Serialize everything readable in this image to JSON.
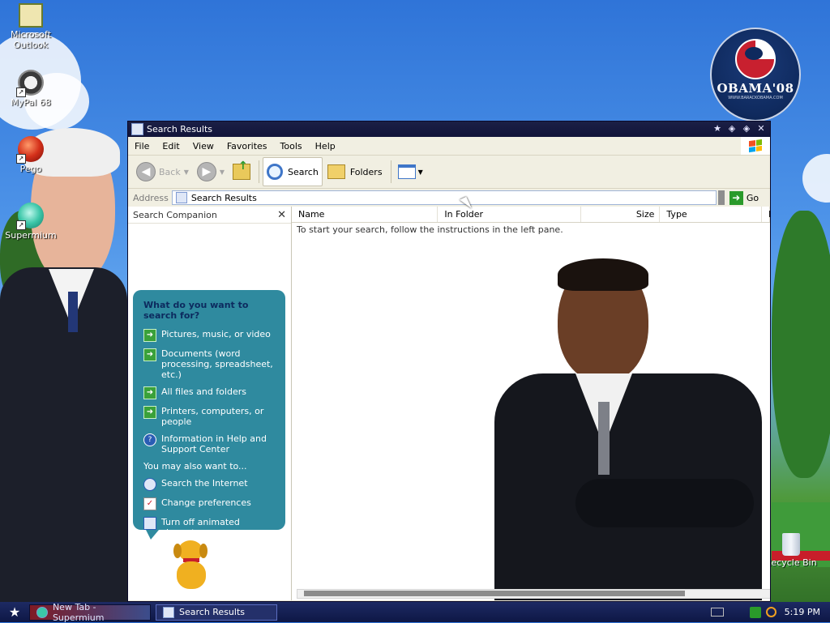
{
  "desktop": {
    "icons": [
      {
        "label": "Microsoft Outlook"
      },
      {
        "label": "MyPal 68"
      },
      {
        "label": "Pego"
      },
      {
        "label": "Supermium"
      },
      {
        "label": "Recycle Bin"
      }
    ],
    "badge": {
      "name": "OBAMA'08",
      "url": "WWW.BARACKOBAMA.COM"
    }
  },
  "window": {
    "title": "Search Results",
    "menu": [
      "File",
      "Edit",
      "View",
      "Favorites",
      "Tools",
      "Help"
    ],
    "toolbar": {
      "back_label": "Back",
      "search_label": "Search",
      "folders_label": "Folders"
    },
    "address": {
      "label": "Address",
      "value": "Search Results",
      "go_label": "Go"
    },
    "companion": {
      "title": "Search Companion",
      "question": "What do you want to search for?",
      "options": [
        "Pictures, music, or video",
        "Documents (word processing, spreadsheet, etc.)",
        "All files and folders",
        "Printers, computers, or people",
        "Information in Help and Support Center"
      ],
      "also_label": "You may also want to...",
      "also": [
        "Search the Internet",
        "Change preferences",
        "Turn off animated character"
      ]
    },
    "results": {
      "columns": [
        "Name",
        "In Folder",
        "Size",
        "Type",
        "D"
      ],
      "hint": "To start your search, follow the instructions in the left pane."
    }
  },
  "taskbar": {
    "tasks": [
      {
        "label": "New Tab - Supermium"
      },
      {
        "label": "Search Results"
      }
    ],
    "clock": "5:19 PM"
  }
}
